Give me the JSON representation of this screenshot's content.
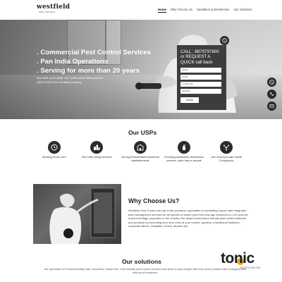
{
  "brand": {
    "logo_text": "westfield",
    "logo_subtext": "PEST CONTROL"
  },
  "nav": {
    "items": [
      {
        "label": "Home",
        "active": true
      },
      {
        "label": "Why Choose Us",
        "active": false
      },
      {
        "label": "Sanitation & Disinfection",
        "active": false
      },
      {
        "label": "Our Solutions",
        "active": false
      }
    ]
  },
  "hero": {
    "lines": [
      ". Commercial Pest Control Services",
      ". Pan India Operations",
      ". Serving for more than 20 years"
    ],
    "certifications": "ISO 9001:2015 QMS, ISO 14001:2015 EMS and ISO 45001:2018 OHS certified company."
  },
  "callback": {
    "title": "CALL : 8879797800 or REQUEST A QUICK call back",
    "fields": [
      {
        "placeholder": "Name"
      },
      {
        "placeholder": "Email"
      },
      {
        "placeholder": "Contact No."
      },
      {
        "placeholder": "Address"
      }
    ],
    "submit_label": "Submit"
  },
  "floating_buttons": [
    {
      "icon": "whatsapp-icon"
    },
    {
      "icon": "phone-icon"
    },
    {
      "icon": "mail-icon"
    }
  ],
  "usps": {
    "title": "Our USPs",
    "items": [
      {
        "icon": "clock-icon",
        "text": "Working Hours 24x7"
      },
      {
        "icon": "city-icon",
        "text": "250 Cities being serviced"
      },
      {
        "icon": "building-icon",
        "text": "Serving Residential/Commercial establishments"
      },
      {
        "icon": "sanitizer-icon",
        "text": "Providing sanitization disinfection services, older than a decade"
      },
      {
        "icon": "molecule-icon",
        "text": "Use of human safe Global Compounds"
      }
    ]
  },
  "why": {
    "title": "Why Choose Us?",
    "body": "Westfield Pest Control are pan India operators, specialists in combating human safe integrated pest management services for all species of insect pest from new age structures to 100 year old ancient heritage properties in the country. We adopt environment friendly pest control methods and products by protecting your dear ones at your homes, gardens, educational institutes, corporate offices, Hospitals, Hotels, Airports etc."
  },
  "solutions": {
    "title": "Our solutions",
    "body": "We specialize in Environmentally safe, odourless, hassle free, child friendly pest control services and strive to help people with their pests problem with ecological safe method of treatment."
  },
  "watermark": {
    "word": "tonic",
    "subtext": "WORLDWIDE"
  },
  "colors": {
    "dark_panel": "#3d3d3d",
    "icon_bg": "#2c2c2c",
    "watermark_accent": "#f2a51f"
  }
}
